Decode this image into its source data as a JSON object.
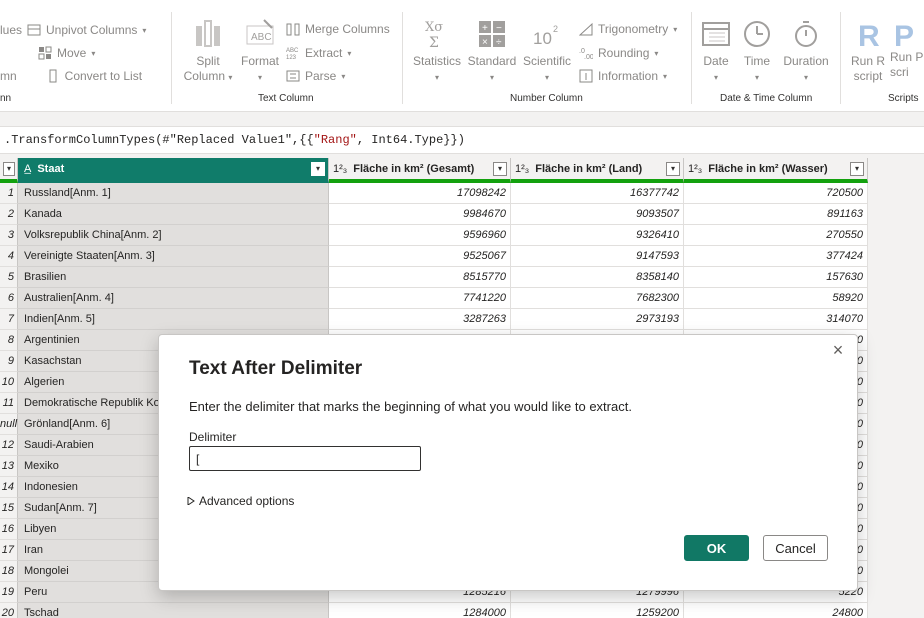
{
  "ribbon": {
    "transform_left": {
      "unpivot_label": "Unpivot Columns",
      "unpivot_prefix": "lues",
      "move_label": "Move",
      "convert_label": "Convert to List",
      "mn_label": "mn",
      "group_prefix": "nn"
    },
    "text_column": {
      "split_label": "Split",
      "split_label2": "Column",
      "format_label": "Format",
      "merge_label": "Merge Columns",
      "extract_label": "Extract",
      "parse_label": "Parse",
      "group_label": "Text Column"
    },
    "number_column": {
      "statistics_label": "Statistics",
      "standard_label": "Standard",
      "scientific_label": "Scientific",
      "trig_label": "Trigonometry",
      "rounding_label": "Rounding",
      "information_label": "Information",
      "group_label": "Number Column"
    },
    "datetime": {
      "date_label": "Date",
      "time_label": "Time",
      "duration_label": "Duration",
      "group_label": "Date & Time Column"
    },
    "scripts": {
      "run_r_label": "Run R",
      "run_r_label2": "script",
      "run_py_label": "Run P",
      "run_py_label2": "scri",
      "group_label": "Scripts"
    }
  },
  "formula": {
    "prefix": ".TransformColumnTypes(#\"Replaced Value1\",{{",
    "string": "\"Rang\"",
    "suffix": ", Int64.Type}})"
  },
  "grid": {
    "columns": [
      "Staat",
      "Fläche in km² (Gesamt)",
      "Fläche in km² (Land)",
      "Fläche in km² (Wasser)"
    ],
    "type_indicator": "1²₃",
    "rows": [
      {
        "idx": "1",
        "staat": "Russland[Anm. 1]",
        "gesamt": "17098242",
        "land": "16377742",
        "wasser": "720500"
      },
      {
        "idx": "2",
        "staat": "Kanada",
        "gesamt": "9984670",
        "land": "9093507",
        "wasser": "891163"
      },
      {
        "idx": "3",
        "staat": "Volksrepublik China[Anm. 2]",
        "gesamt": "9596960",
        "land": "9326410",
        "wasser": "270550"
      },
      {
        "idx": "4",
        "staat": "Vereinigte Staaten[Anm. 3]",
        "gesamt": "9525067",
        "land": "9147593",
        "wasser": "377424"
      },
      {
        "idx": "5",
        "staat": "Brasilien",
        "gesamt": "8515770",
        "land": "8358140",
        "wasser": "157630"
      },
      {
        "idx": "6",
        "staat": "Australien[Anm. 4]",
        "gesamt": "7741220",
        "land": "7682300",
        "wasser": "58920"
      },
      {
        "idx": "7",
        "staat": "Indien[Anm. 5]",
        "gesamt": "3287263",
        "land": "2973193",
        "wasser": "314070"
      },
      {
        "idx": "8",
        "staat": "Argentinien",
        "gesamt": "",
        "land": "",
        "wasser": "0"
      },
      {
        "idx": "9",
        "staat": "Kasachstan",
        "gesamt": "",
        "land": "",
        "wasser": "0"
      },
      {
        "idx": "10",
        "staat": "Algerien",
        "gesamt": "",
        "land": "",
        "wasser": "0"
      },
      {
        "idx": "11",
        "staat": "Demokratische Republik Ko",
        "gesamt": "",
        "land": "",
        "wasser": "0"
      },
      {
        "idx": "null",
        "staat": "Grönland[Anm. 6]",
        "gesamt": "",
        "land": "",
        "wasser": "0"
      },
      {
        "idx": "12",
        "staat": "Saudi-Arabien",
        "gesamt": "",
        "land": "",
        "wasser": "0"
      },
      {
        "idx": "13",
        "staat": "Mexiko",
        "gesamt": "",
        "land": "",
        "wasser": "0"
      },
      {
        "idx": "14",
        "staat": "Indonesien",
        "gesamt": "",
        "land": "",
        "wasser": "0"
      },
      {
        "idx": "15",
        "staat": "Sudan[Anm. 7]",
        "gesamt": "",
        "land": "",
        "wasser": "0"
      },
      {
        "idx": "16",
        "staat": "Libyen",
        "gesamt": "",
        "land": "",
        "wasser": "0"
      },
      {
        "idx": "17",
        "staat": "Iran",
        "gesamt": "",
        "land": "",
        "wasser": "0"
      },
      {
        "idx": "18",
        "staat": "Mongolei",
        "gesamt": "",
        "land": "",
        "wasser": "0"
      },
      {
        "idx": "19",
        "staat": "Peru",
        "gesamt": "1285216",
        "land": "1279996",
        "wasser": "5220"
      },
      {
        "idx": "20",
        "staat": "Tschad",
        "gesamt": "1284000",
        "land": "1259200",
        "wasser": "24800"
      }
    ]
  },
  "dialog": {
    "title": "Text After Delimiter",
    "description": "Enter the delimiter that marks the beginning of what you would like to extract.",
    "field_label": "Delimiter",
    "field_value": "[",
    "advanced_label": "Advanced options",
    "ok_label": "OK",
    "cancel_label": "Cancel",
    "close_glyph": "×"
  },
  "colors": {
    "accent": "#117865",
    "selected_header": "#107c6a",
    "header_underline": "#13a10e"
  }
}
